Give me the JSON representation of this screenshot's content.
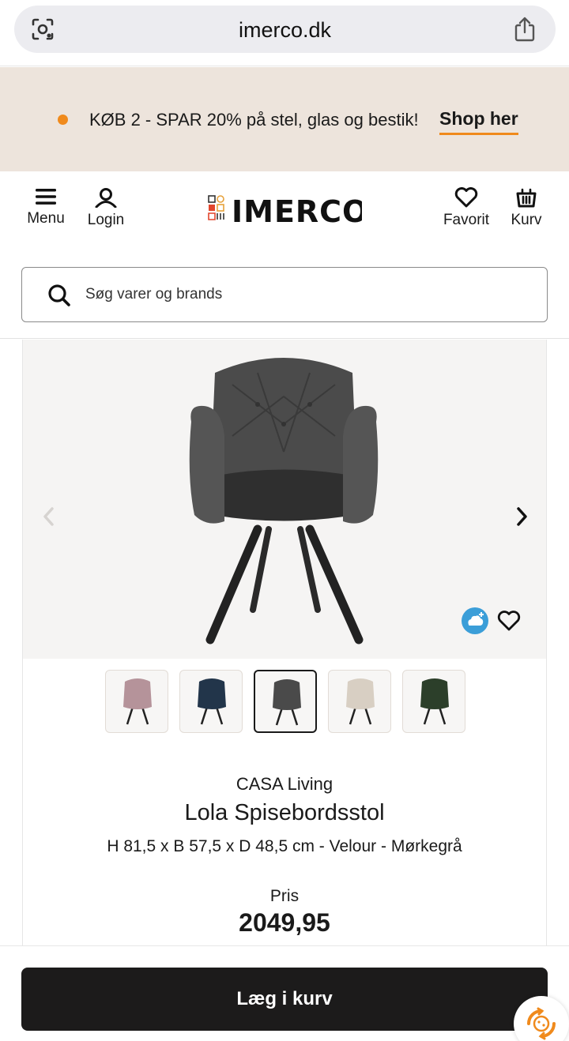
{
  "browser": {
    "url": "imerco.dk",
    "lens_icon": "camera-lens-icon",
    "share_icon": "share-icon"
  },
  "promo": {
    "text": "KØB 2 - SPAR 20% på stel, glas og bestik!",
    "link_label": "Shop her",
    "accent": "#f08a1c",
    "background": "#ede4dc"
  },
  "header": {
    "menu_label": "Menu",
    "login_label": "Login",
    "favorite_label": "Favorit",
    "cart_label": "Kurv",
    "logo_text": "IMERCO"
  },
  "search": {
    "placeholder": "Søg varer og brands"
  },
  "product": {
    "brand": "CASA Living",
    "title": "Lola Spisebordsstol",
    "description": "H 81,5 x B 57,5 x D 48,5 cm - Velour - Mørkegrå",
    "price_label": "Pris",
    "price": "2049,95",
    "variants": [
      {
        "name": "rosa",
        "color": "#b5939a",
        "selected": false
      },
      {
        "name": "blå",
        "color": "#22354a",
        "selected": false
      },
      {
        "name": "mørkegrå",
        "color": "#4a4a4a",
        "selected": true
      },
      {
        "name": "beige",
        "color": "#d8cfc3",
        "selected": false
      },
      {
        "name": "grøn",
        "color": "#2c3f2a",
        "selected": false
      }
    ]
  },
  "actions": {
    "add_to_cart_label": "Læg i kurv"
  }
}
